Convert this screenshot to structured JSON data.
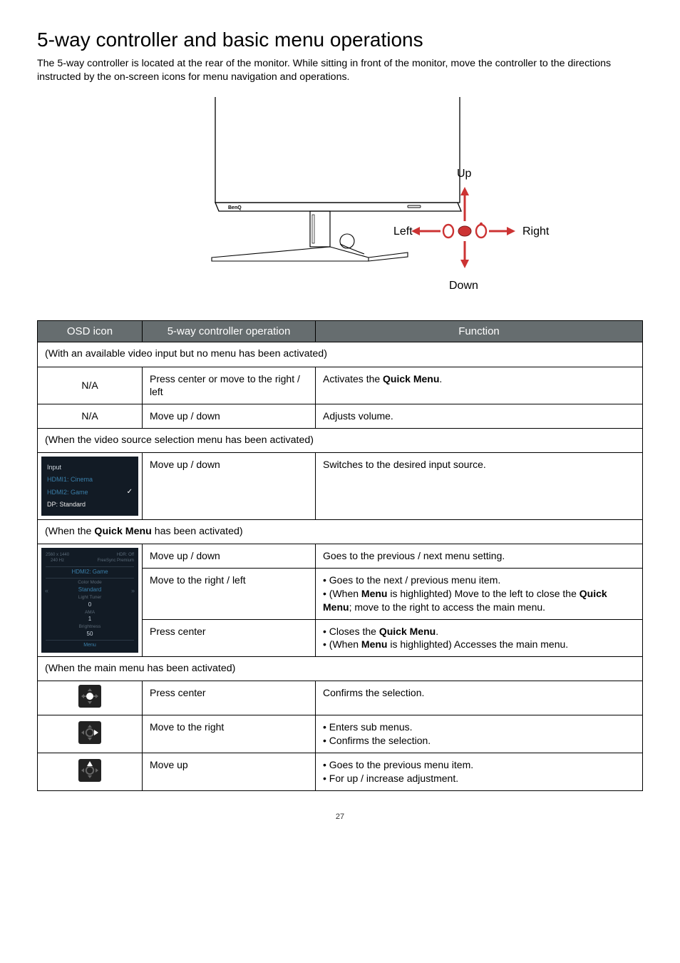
{
  "heading": "5-way controller and basic menu operations",
  "intro": "The 5-way controller is located at the rear of the monitor. While sitting in front of the monitor, move the controller to the directions instructed by the on-screen icons for menu navigation and operations.",
  "diagram": {
    "up": "Up",
    "left": "Left",
    "right": "Right",
    "down": "Down"
  },
  "tbl": {
    "header_osd": "OSD icon",
    "header_op": "5-way controller operation",
    "header_fn": "Function",
    "sec_noinput": "(With an available video input but no menu has been activated)",
    "row1": {
      "osd": "N/A",
      "op": "Press center or move to the right / left",
      "fn_prefix": "Activates the ",
      "fn_bold": "Quick Menu",
      "fn_suffix": "."
    },
    "row2": {
      "osd": "N/A",
      "op": "Move up / down",
      "fn": "Adjusts volume."
    },
    "sec_source": "(When the video source selection menu has been activated)",
    "source_osd": {
      "title": "Input",
      "line1": "HDMI1: Cinema",
      "line2": "HDMI2: Game",
      "line3": "DP: Standard"
    },
    "row3": {
      "op": "Move up / down",
      "fn": "Switches to the desired input source."
    },
    "sec_quick_prefix": "(When the ",
    "sec_quick_bold": "Quick Menu",
    "sec_quick_suffix": " has been activated)",
    "quick_osd": {
      "res_left": "2560 x 1440",
      "res_left2": "240 Hz",
      "res_right": "HDR: Off",
      "res_right2": "FreeSync Premium",
      "mode_line": "HDMI2: Game",
      "lbl1": "Color Mode",
      "val1": "Standard",
      "lbl2": "Light Tuner",
      "val2": "0",
      "lbl3": "AMA",
      "val3": "1",
      "lbl4": "Brightness",
      "val4": "50",
      "menu": "Menu"
    },
    "row4": {
      "op": "Move up / down",
      "fn": "Goes to the previous / next menu setting."
    },
    "row5": {
      "op": "Move to the right / left",
      "bul1": "Goes to the next / previous menu item.",
      "bul2_p1": "(When ",
      "bul2_b1": "Menu",
      "bul2_p2": " is highlighted) Move to the left to close the ",
      "bul2_b2": "Quick Menu",
      "bul2_p3": "; move to the right to access the main menu."
    },
    "row6": {
      "op": "Press center",
      "bul1_p1": "Closes the ",
      "bul1_b": "Quick Menu",
      "bul1_p2": ".",
      "bul2_p1": "(When ",
      "bul2_b": "Menu",
      "bul2_p2": " is highlighted) Accesses the main menu."
    },
    "sec_main": "(When the main menu has been activated)",
    "row7": {
      "op": "Press center",
      "fn": "Confirms the selection."
    },
    "row8": {
      "op": "Move to the right",
      "bul1": "Enters sub menus.",
      "bul2": "Confirms the selection."
    },
    "row9": {
      "op": "Move up",
      "bul1": "Goes to the previous menu item.",
      "bul2": "For up / increase adjustment."
    }
  },
  "page": "27"
}
